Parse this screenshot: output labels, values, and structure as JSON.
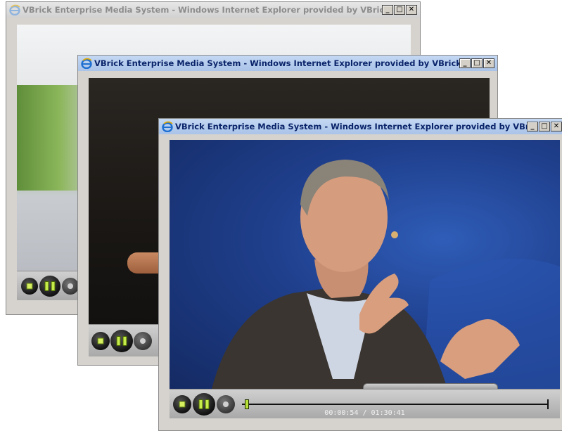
{
  "colors": {
    "title_active_text": "#0a246a",
    "title_inactive_text": "#8c8c8c",
    "accent_green": "#b8e03a"
  },
  "windows": [
    {
      "title": "VBrick Enterprise Media System - Windows Internet Explorer provided by VBrick Sys...",
      "controls": {
        "minimize": "_",
        "maximize": "□",
        "close": "✕"
      },
      "player": {
        "stop": "stop-icon",
        "pause": "pause-icon",
        "record": "record-icon"
      }
    },
    {
      "title": "VBrick Enterprise Media System - Windows Internet Explorer provided by VBrick Sys...",
      "controls": {
        "minimize": "_",
        "maximize": "□",
        "close": "✕"
      },
      "player": {
        "stop": "stop-icon",
        "pause": "pause-icon",
        "record": "record-icon"
      }
    },
    {
      "title": "VBrick Enterprise Media System - Windows Internet Explorer provided by VBrick Sys...",
      "controls": {
        "minimize": "_",
        "maximize": "□",
        "close": "✕"
      },
      "player": {
        "stop": "stop-icon",
        "pause": "pause-icon",
        "record": "record-icon",
        "time_current": "00:00:54",
        "time_total": "01:30:41",
        "time_display": "00:00:54 / 01:30:41",
        "progress_fraction": 0.0099
      }
    }
  ]
}
